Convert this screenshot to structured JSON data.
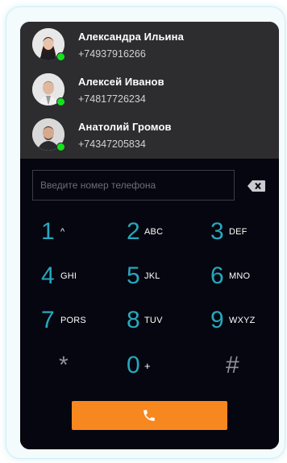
{
  "contacts": [
    {
      "name": "Александра Ильина",
      "phone": "+74937916266",
      "status": "online"
    },
    {
      "name": "Алексей Иванов",
      "phone": "+74817726234",
      "status": "online"
    },
    {
      "name": "Анатолий Громов",
      "phone": "+74347205834",
      "status": "online"
    }
  ],
  "dialer": {
    "placeholder": "Введите номер телефона",
    "backspace_icon": "backspace-icon",
    "keys": [
      {
        "digit": "1",
        "letters": "^"
      },
      {
        "digit": "2",
        "letters": "ABC"
      },
      {
        "digit": "3",
        "letters": "DEF"
      },
      {
        "digit": "4",
        "letters": "GHI"
      },
      {
        "digit": "5",
        "letters": "JKL"
      },
      {
        "digit": "6",
        "letters": "MNO"
      },
      {
        "digit": "7",
        "letters": "PORS"
      },
      {
        "digit": "8",
        "letters": "TUV"
      },
      {
        "digit": "9",
        "letters": "WXYZ"
      },
      {
        "digit": "*",
        "letters": ""
      },
      {
        "digit": "0",
        "letters": "+"
      },
      {
        "digit": "#",
        "letters": ""
      }
    ],
    "call_icon": "phone-icon"
  },
  "colors": {
    "accent": "#27a7bd",
    "call_button": "#f7871f",
    "online": "#14e21e",
    "contacts_bg": "#2d2d30",
    "dialpad_bg": "#05060f"
  }
}
